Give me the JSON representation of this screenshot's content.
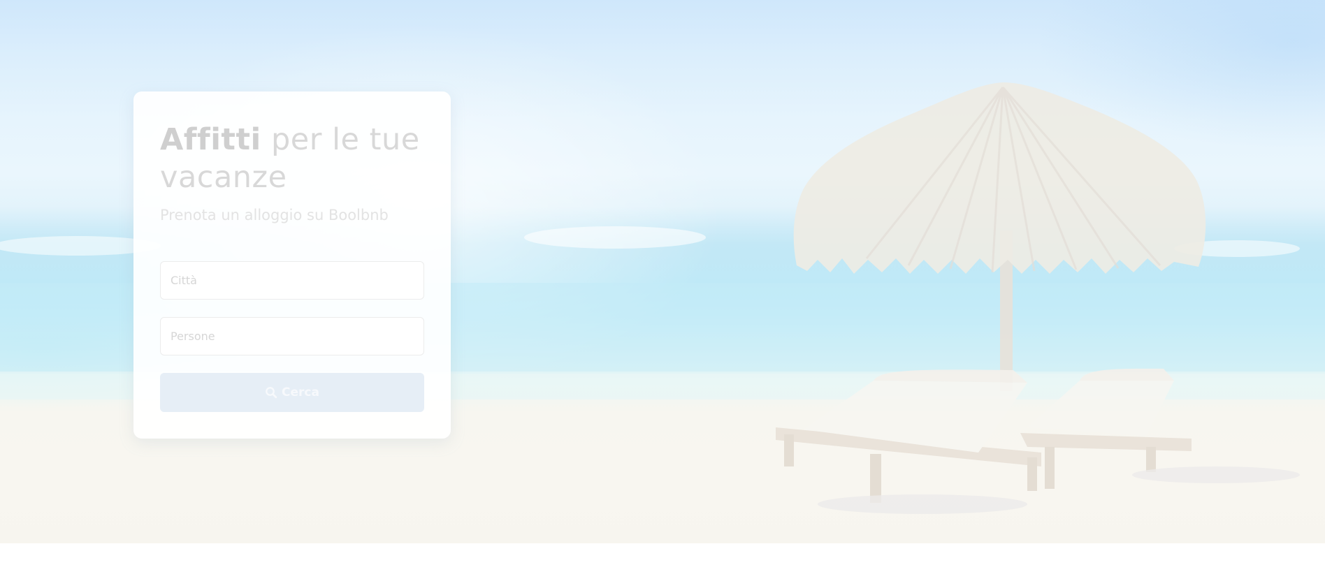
{
  "hero": {
    "title_bold": "Affitti",
    "title_rest": " per le tue vacanze",
    "subtitle": "Prenota un alloggio su Boolbnb"
  },
  "search": {
    "city_placeholder": "Città",
    "people_placeholder": "Persone",
    "button_label": "Cerca",
    "button_icon": "search-icon"
  },
  "colors": {
    "card_background": "#ffffff",
    "button_background": "#e6eef6",
    "sky": "#dbeefc",
    "sea": "#bfe9f7",
    "sand": "#f8f6f0"
  }
}
